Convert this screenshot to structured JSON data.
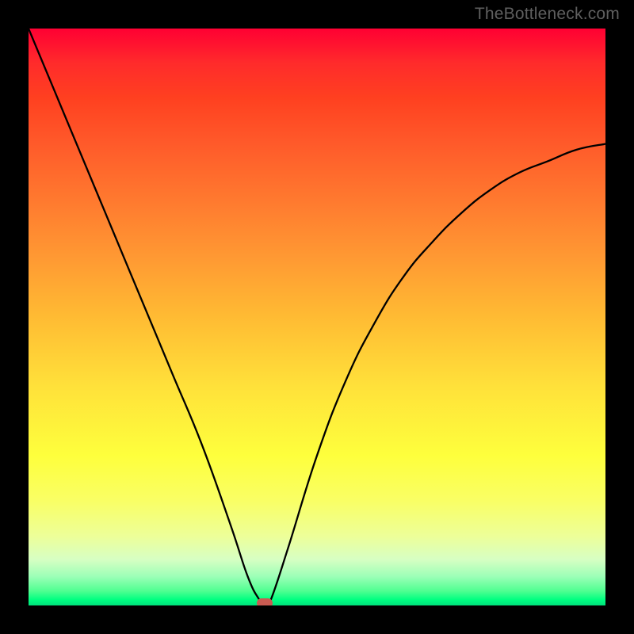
{
  "watermark": "TheBottleneck.com",
  "chart_data": {
    "type": "line",
    "title": "",
    "xlabel": "",
    "ylabel": "",
    "xlim": [
      0,
      100
    ],
    "ylim": [
      0,
      100
    ],
    "grid": false,
    "legend": false,
    "background_gradient": {
      "stops": [
        {
          "pos": 0,
          "color": "#ff0033"
        },
        {
          "pos": 20,
          "color": "#ff5a2a"
        },
        {
          "pos": 40,
          "color": "#ff9a33"
        },
        {
          "pos": 60,
          "color": "#ffe13a"
        },
        {
          "pos": 80,
          "color": "#feff66"
        },
        {
          "pos": 95,
          "color": "#9cffb7"
        },
        {
          "pos": 100,
          "color": "#00e27c"
        }
      ]
    },
    "series": [
      {
        "name": "bottleneck-curve",
        "x": [
          0,
          5,
          10,
          15,
          20,
          25,
          30,
          35,
          38,
          40,
          41,
          42,
          45,
          50,
          55,
          60,
          65,
          70,
          75,
          80,
          85,
          90,
          95,
          100
        ],
        "y": [
          100,
          88,
          76,
          64,
          52,
          40,
          28,
          14,
          5,
          1,
          0,
          1,
          10,
          26,
          39,
          49,
          57,
          63,
          68,
          72,
          75,
          77,
          79,
          80
        ]
      }
    ],
    "marker": {
      "name": "optimal-point",
      "x": 41,
      "y": 0,
      "color": "#c95b52"
    }
  }
}
